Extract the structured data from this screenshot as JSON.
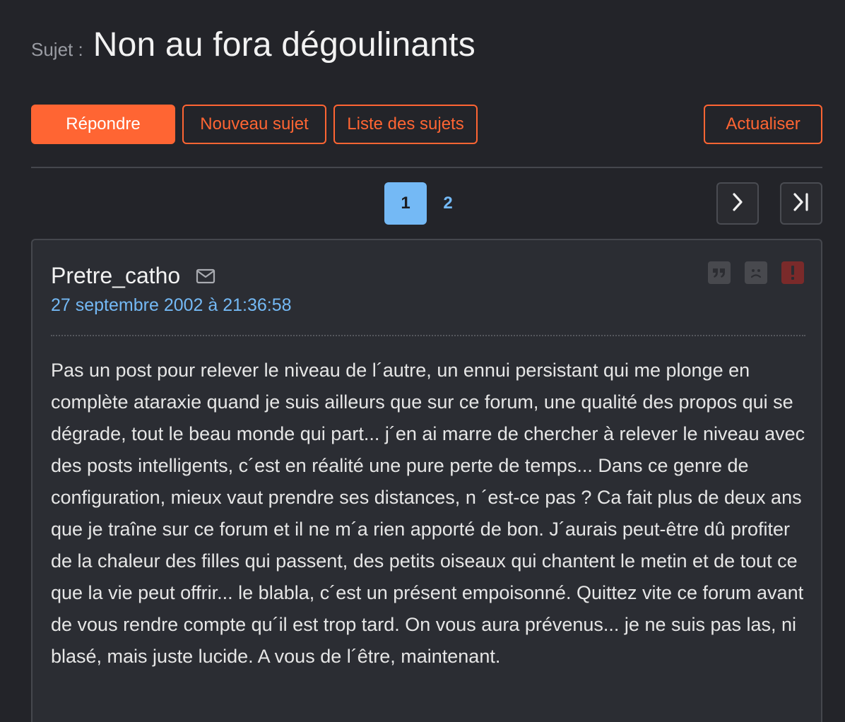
{
  "header": {
    "subject_prefix": "Sujet :",
    "title": "Non au fora dégoulinants"
  },
  "toolbar": {
    "reply_label": "Répondre",
    "new_topic_label": "Nouveau sujet",
    "topic_list_label": "Liste des sujets",
    "refresh_label": "Actualiser"
  },
  "pagination": {
    "current_page": "1",
    "pages": [
      "1",
      "2"
    ],
    "next_icon": "chevron-right-icon",
    "last_icon": "last-page-icon"
  },
  "post": {
    "author": "Pretre_catho",
    "date": "27 septembre 2002 à 21:36:58",
    "icons": [
      "mail-icon",
      "quote-icon",
      "sad-face-icon",
      "report-icon"
    ],
    "body": "Pas un post pour relever le niveau de l´autre, un ennui persistant qui me plonge en complète ataraxie quand je suis ailleurs que sur ce forum, une qualité des propos qui se dégrade, tout le beau monde qui part... j´en ai marre de chercher à relever le niveau avec des posts intelligents, c´est en réalité une pure perte de temps... Dans ce genre de configuration, mieux vaut prendre ses distances, n ´est-ce pas ? Ca fait plus de deux ans que je traîne sur ce forum et il ne m´a rien apporté de bon. J´aurais peut-être dû profiter de la chaleur des filles qui passent, des petits oiseaux qui chantent le metin et de tout ce que la vie peut offrir... le blabla, c´est un présent empoisonné. Quittez vite ce forum avant de vous rendre compte qu´il est trop tard. On vous aura prévenus... je ne suis pas las, ni blasé, mais juste lucide. A vous de l´être, maintenant."
  },
  "colors": {
    "background": "#232429",
    "accent": "#ff6533",
    "link": "#74b9f5",
    "report": "#7a2a2a"
  }
}
